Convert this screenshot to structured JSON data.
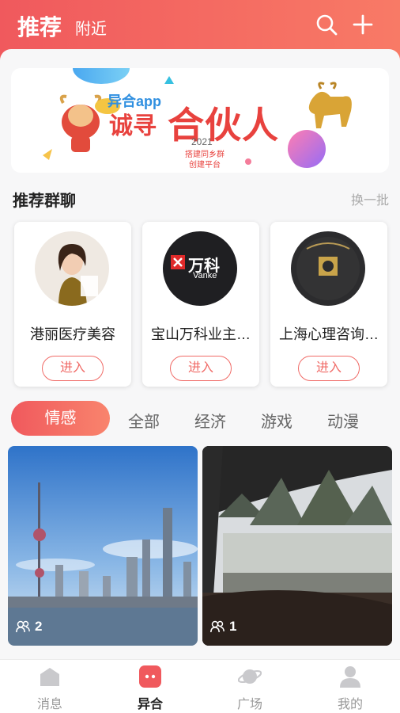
{
  "header": {
    "tab_active": "推荐",
    "tab_nearby": "附近"
  },
  "banner": {
    "app_name": "异合app",
    "headline_prefix": "诚寻",
    "headline": "合伙人",
    "year": "2021",
    "subline1": "搭建同乡群",
    "subline2": "创建平台"
  },
  "recommend": {
    "title": "推荐群聊",
    "refresh": "换一批",
    "enter_label": "进入",
    "groups": [
      {
        "name": "港丽医疗美容"
      },
      {
        "name": "宝山万科业主…",
        "logo_text": "万科",
        "logo_sub": "Vanke"
      },
      {
        "name": "上海心理咨询…"
      }
    ]
  },
  "categories": {
    "active": "情感",
    "items": [
      "全部",
      "经济",
      "游戏",
      "动漫"
    ]
  },
  "feed": [
    {
      "count": "2"
    },
    {
      "count": "1"
    }
  ],
  "bottom_nav": [
    {
      "label": "消息"
    },
    {
      "label": "异合"
    },
    {
      "label": "广场"
    },
    {
      "label": "我的"
    }
  ],
  "colors": {
    "accent": "#f0595d",
    "accent_light": "#f9846d"
  }
}
